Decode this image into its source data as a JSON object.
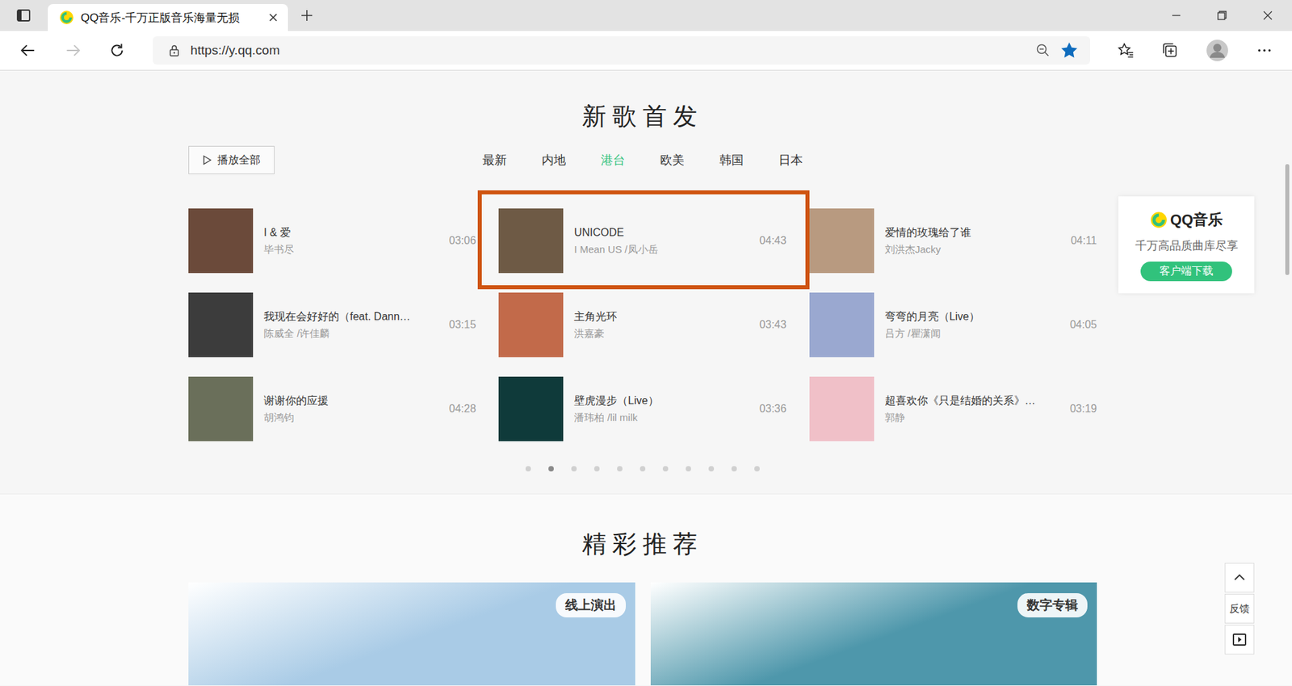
{
  "browser": {
    "tab_title": "QQ音乐-千万正版音乐海量无损",
    "url": "https://y.qq.com",
    "forward_disabled": true,
    "favorite": true
  },
  "new_songs": {
    "title": "新歌首发",
    "play_all": "播放全部",
    "tabs": [
      {
        "label": "最新",
        "selected": false
      },
      {
        "label": "内地",
        "selected": false
      },
      {
        "label": "港台",
        "selected": true
      },
      {
        "label": "欧美",
        "selected": false
      },
      {
        "label": "韩国",
        "selected": false
      },
      {
        "label": "日本",
        "selected": false
      }
    ],
    "songs": [
      {
        "name": "I & 爱",
        "artist": "毕书尽",
        "duration": "03:06",
        "highlighted": false,
        "color": "#6b4a3a"
      },
      {
        "name": "UNICODE",
        "artist": "I Mean US /凤小岳",
        "duration": "04:43",
        "highlighted": true,
        "color": "#6e5a45"
      },
      {
        "name": "爱情的玫瑰给了谁",
        "artist": "刘洪杰Jacky",
        "duration": "04:11",
        "highlighted": false,
        "color": "#b89a80"
      },
      {
        "name": "我现在会好好的（feat. Dann…",
        "artist": "陈威全 /许佳麟",
        "duration": "03:15",
        "highlighted": false,
        "color": "#3c3c3c"
      },
      {
        "name": "主角光环",
        "artist": "洪嘉豪",
        "duration": "03:43",
        "highlighted": false,
        "color": "#c26a4a"
      },
      {
        "name": "弯弯的月亮（Live）",
        "artist": "吕方 /瞿潇闻",
        "duration": "04:05",
        "highlighted": false,
        "color": "#9aa8d0"
      },
      {
        "name": "谢谢你的应援",
        "artist": "胡鸿钧",
        "duration": "04:28",
        "highlighted": false,
        "color": "#6a6f5a"
      },
      {
        "name": "壁虎漫步（Live）",
        "artist": "潘玮柏 /lil milk",
        "duration": "03:36",
        "highlighted": false,
        "color": "#0f3a3a"
      },
      {
        "name": "超喜欢你《只是结婚的关系》…",
        "artist": "郭静",
        "duration": "03:19",
        "highlighted": false,
        "color": "#f0c0c8"
      }
    ],
    "pages": [
      {
        "selected": false
      },
      {
        "selected": true
      },
      {
        "selected": false
      },
      {
        "selected": false
      },
      {
        "selected": false
      },
      {
        "selected": false
      },
      {
        "selected": false
      },
      {
        "selected": false
      },
      {
        "selected": false
      },
      {
        "selected": false
      },
      {
        "selected": false
      }
    ]
  },
  "promo": {
    "logo": "QQ音乐",
    "slogan": "千万高品质曲库尽享",
    "button": "客户端下载"
  },
  "recommend": {
    "title": "精彩推荐",
    "banners": [
      {
        "tag": "线上演出",
        "color": "#a9cbe6"
      },
      {
        "tag": "数字专辑",
        "color": "#4e97ab"
      }
    ]
  },
  "side_tools": {
    "feedback": "反馈"
  }
}
